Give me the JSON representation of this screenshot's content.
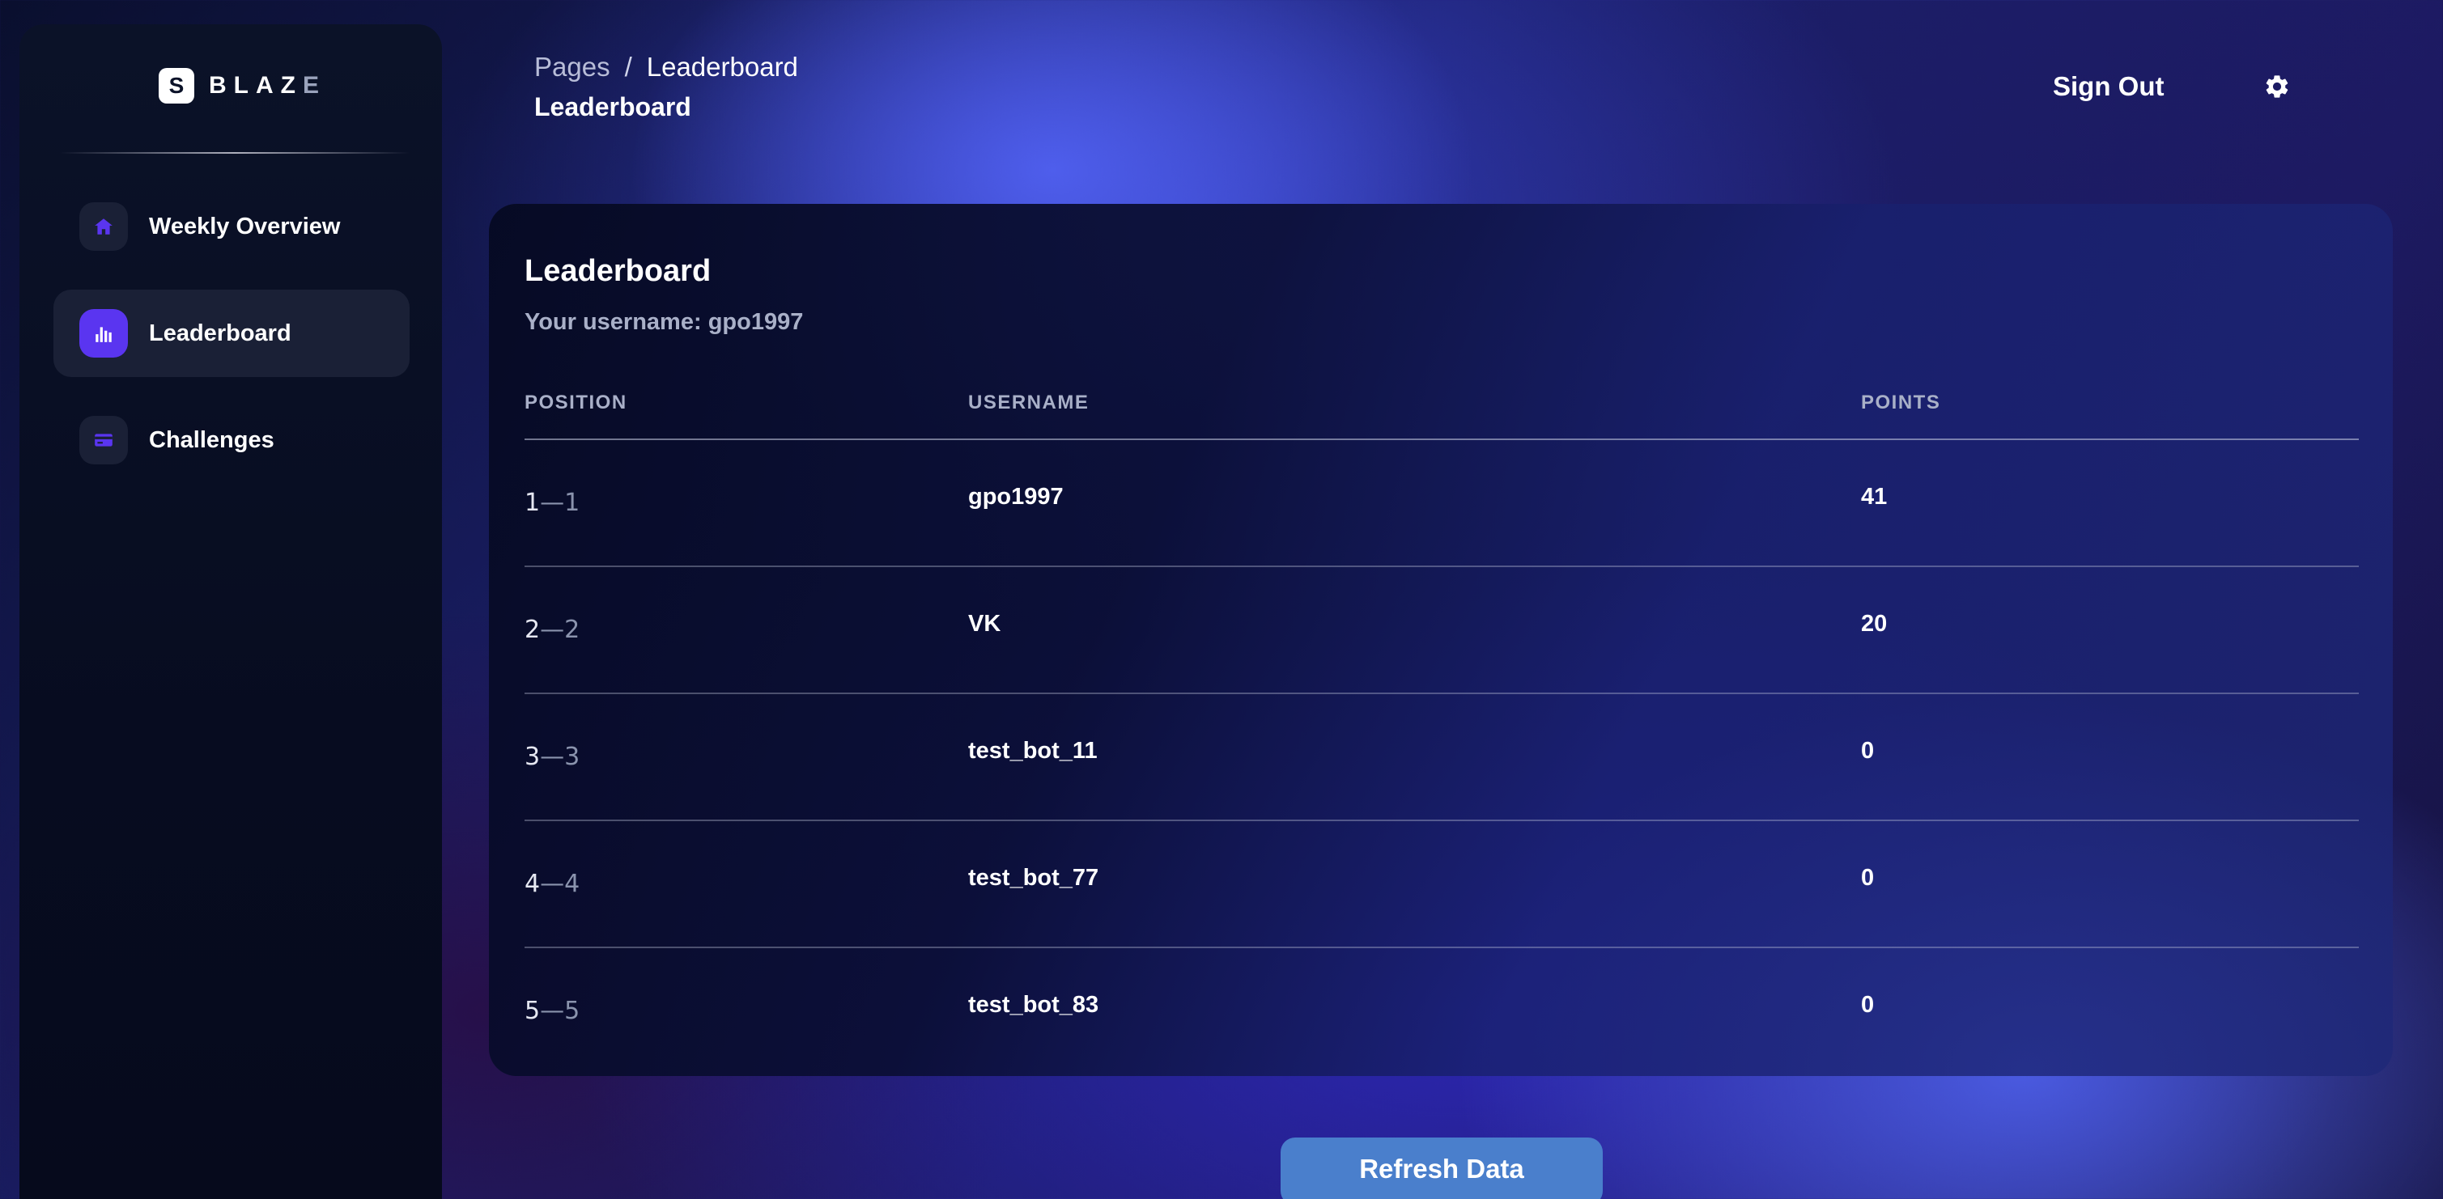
{
  "brand": {
    "logo_letter": "S",
    "name_main": "BLAZ",
    "name_end": "E"
  },
  "sidebar": {
    "items": [
      {
        "label": "Weekly Overview",
        "icon": "home-icon",
        "active": false
      },
      {
        "label": "Leaderboard",
        "icon": "bar-chart-icon",
        "active": true
      },
      {
        "label": "Challenges",
        "icon": "credit-card-icon",
        "active": false
      }
    ]
  },
  "header": {
    "breadcrumb_root": "Pages",
    "breadcrumb_sep": "/",
    "breadcrumb_current": "Leaderboard",
    "title": "Leaderboard",
    "sign_out_label": "Sign Out",
    "settings_icon": "gear-icon"
  },
  "leaderboard": {
    "title": "Leaderboard",
    "subtitle": "Your username: gpo1997",
    "columns": {
      "position": "POSITION",
      "username": "USERNAME",
      "points": "POINTS"
    },
    "rows": [
      {
        "position": "1",
        "position_sub": "—1",
        "username": "gpo1997",
        "points": "41"
      },
      {
        "position": "2",
        "position_sub": "—2",
        "username": "VK",
        "points": "20"
      },
      {
        "position": "3",
        "position_sub": "—3",
        "username": "test_bot_11",
        "points": "0"
      },
      {
        "position": "4",
        "position_sub": "—4",
        "username": "test_bot_77",
        "points": "0"
      },
      {
        "position": "5",
        "position_sub": "—5",
        "username": "test_bot_83",
        "points": "0"
      }
    ]
  },
  "actions": {
    "refresh_label": "Refresh Data"
  },
  "colors": {
    "accent": "#5a35f0",
    "button": "#4a7fcc"
  }
}
